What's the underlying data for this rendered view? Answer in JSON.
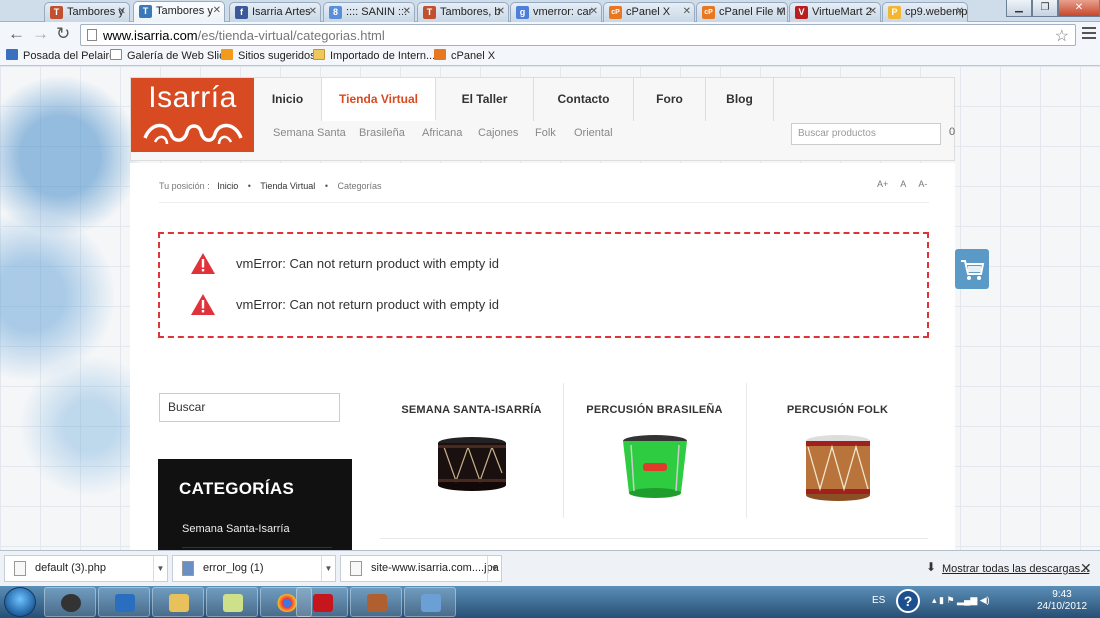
{
  "browser": {
    "tabs": [
      {
        "label": "Tambores y",
        "fav": "T",
        "color": "#c0502f"
      },
      {
        "label": "Tambores y",
        "fav": "T",
        "color": "#3a79b8"
      },
      {
        "label": "Isarria Artes",
        "fav": "f",
        "color": "#3b5998"
      },
      {
        "label": ":::: SANIN :::",
        "fav": "8",
        "color": "#5a8ed6"
      },
      {
        "label": "Tambores, b",
        "fav": "T",
        "color": "#c0502f"
      },
      {
        "label": "vmerror: car",
        "fav": "g",
        "color": "#4c7fd9"
      },
      {
        "label": "cPanel X",
        "fav": "cP",
        "color": "#e87722"
      },
      {
        "label": "cPanel File M",
        "fav": "cP",
        "color": "#e87722"
      },
      {
        "label": "VirtueMart 2",
        "fav": "V",
        "color": "#b82020"
      },
      {
        "label": "cp9.webemp",
        "fav": "P",
        "color": "#f2b630"
      }
    ],
    "url_host": "www.isarria.com",
    "url_path": "/es/tienda-virtual/categorias.html",
    "bookmarks": [
      "Posada del Pelaire",
      "Galería de Web Slice",
      "Sitios sugeridos",
      "Importado de Intern...",
      "cPanel X"
    ]
  },
  "site": {
    "logo_text": "Isarría",
    "nav": [
      "Inicio",
      "Tienda Virtual",
      "El Taller",
      "Contacto",
      "Foro",
      "Blog"
    ],
    "subnav": [
      "Semana Santa",
      "Brasileña",
      "Africana",
      "Cajones",
      "Folk",
      "Oriental"
    ],
    "search_products_placeholder": "Buscar productos",
    "cart_count": "0"
  },
  "breadcrumb": {
    "prefix": "Tu posición :",
    "items": [
      "Inicio",
      "Tienda Virtual",
      "Categorías"
    ]
  },
  "font_controls": [
    "A+",
    "A",
    "A-"
  ],
  "errors": [
    "vmError: Can not return product with empty id",
    "vmError: Can not return product with empty id"
  ],
  "search_label": "Buscar",
  "categories": {
    "title": "CATEGORÍAS",
    "items": [
      "Semana Santa-Isarría"
    ]
  },
  "products": [
    {
      "name": "SEMANA SANTA-ISARRÍA"
    },
    {
      "name": "PERCUSIÓN BRASILEÑA"
    },
    {
      "name": "PERCUSIÓN FOLK"
    }
  ],
  "downloads": {
    "items": [
      "default (3).php",
      "error_log (1)",
      "site-www.isarria.com....jpa"
    ],
    "show_all": "Mostrar todas las descargas...",
    "close": "✕"
  },
  "taskbar": {
    "lang": "ES",
    "time": "9:43",
    "date": "24/10/2012"
  },
  "colors": {
    "brand": "#d84a21",
    "error": "#e0323a",
    "cart": "#5b9ac7"
  }
}
